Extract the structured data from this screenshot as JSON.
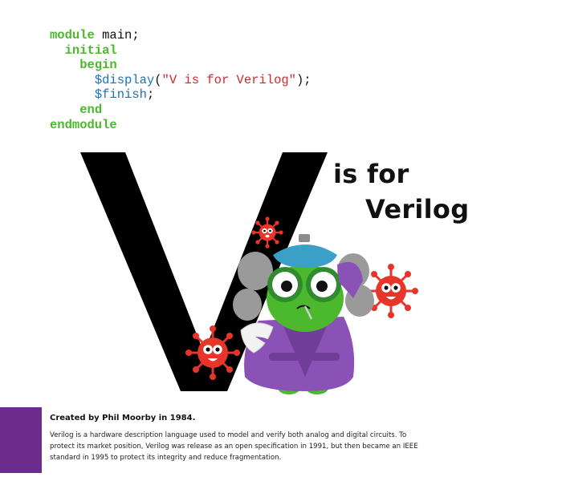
{
  "code": {
    "l1_kw": "module",
    "l1_rest": " main;",
    "l2_kw": "initial",
    "l3_kw": "begin",
    "l4_sys": "$display",
    "l4_open": "(",
    "l4_str": "\"V is for Verilog\"",
    "l4_close": ");",
    "l5_sys": "$finish",
    "l5_rest": ";",
    "l6_kw": "end",
    "l7_kw": "endmodule"
  },
  "headline": {
    "line1": "is for",
    "line2": "Verilog"
  },
  "footer": {
    "credit": "Created by Phil Moorby in 1984.",
    "description": "Verilog is a hardware description language used to model and verify both analog and digital circuits. To protect its market position, Verilog was release as an open specification in 1991, but then became an IEEE standard in 1995 to protect its integrity and reduce fragmentation."
  },
  "colors": {
    "keyword": "#4bb82d",
    "system_task": "#1a73b5",
    "string": "#d6262b",
    "accent_tab": "#6c2c8a",
    "virus": "#e8352a",
    "robe": "#8a52b6"
  },
  "icons": [
    "virus-icon",
    "sick-mascot-icon"
  ]
}
